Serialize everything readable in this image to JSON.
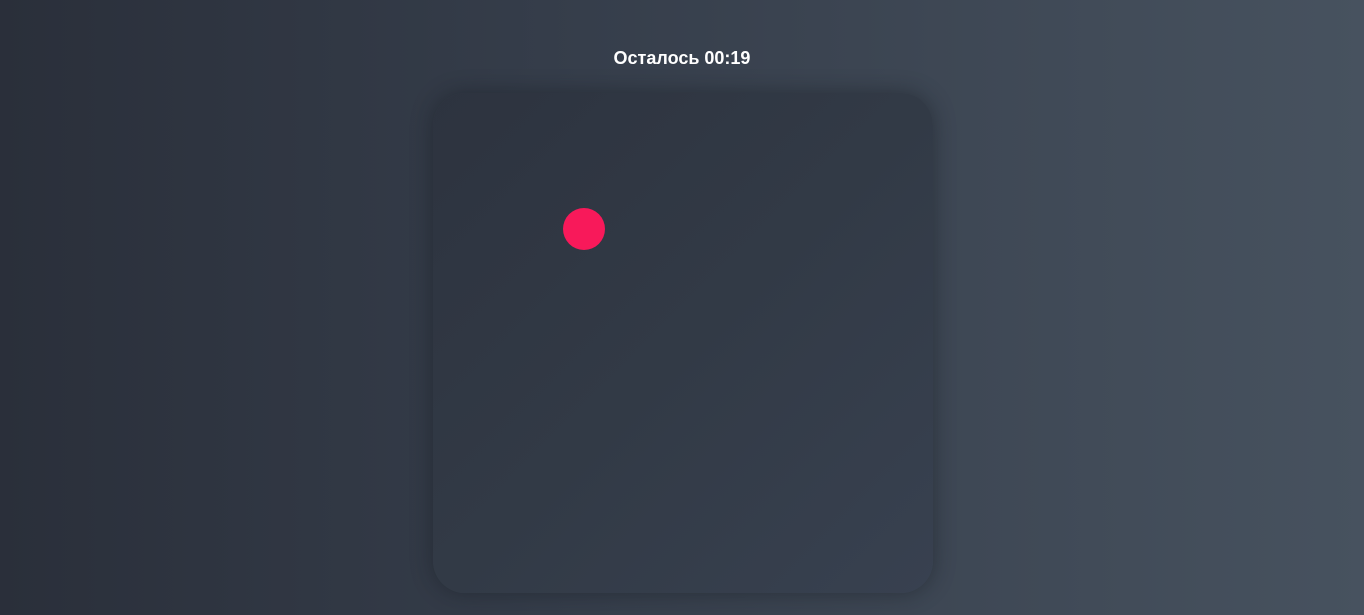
{
  "timer": {
    "label": "Осталось",
    "value": "00:19"
  },
  "game": {
    "target": {
      "icon": "red-circle",
      "color": "#f8195a"
    }
  }
}
